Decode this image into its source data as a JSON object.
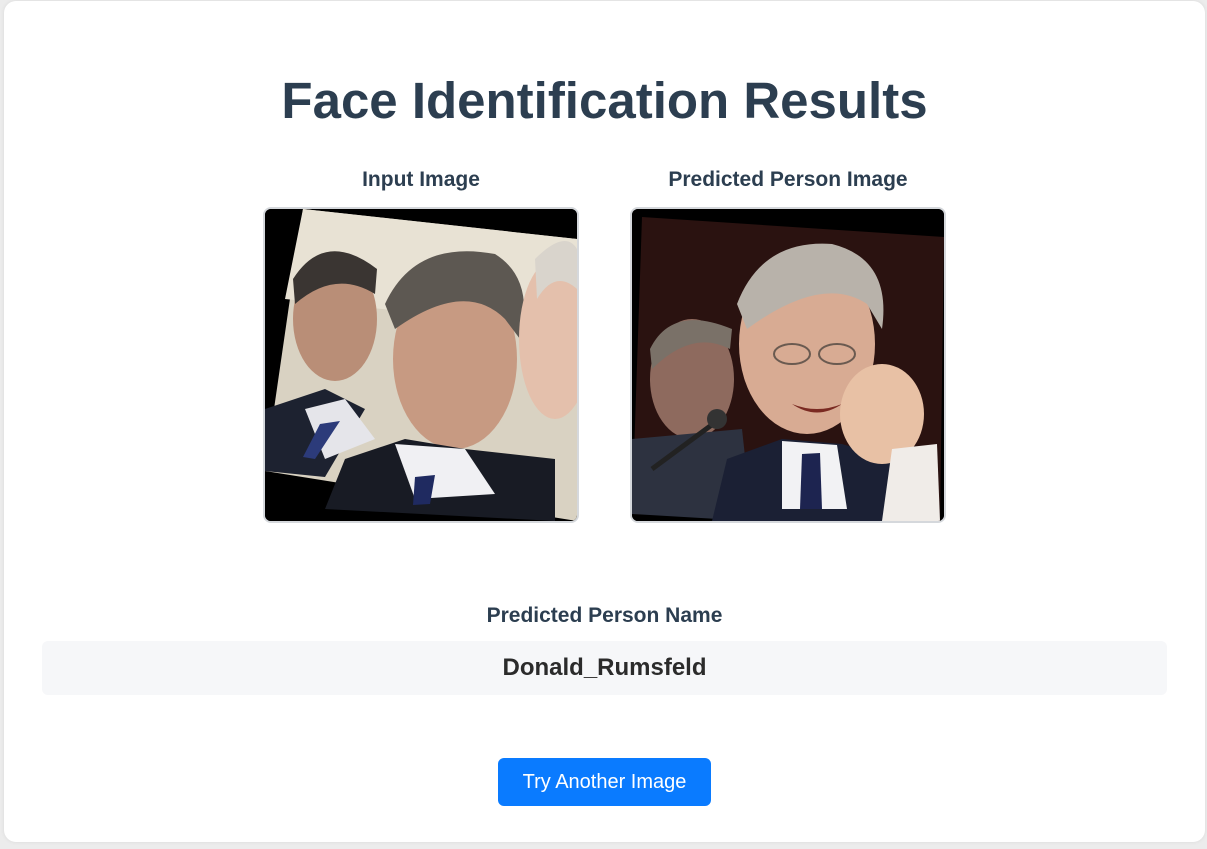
{
  "page": {
    "title": "Face Identification Results"
  },
  "images": {
    "input_label": "Input Image",
    "predicted_label": "Predicted Person Image"
  },
  "result": {
    "name_label": "Predicted Person Name",
    "name_value": "Donald_Rumsfeld"
  },
  "actions": {
    "try_again_label": "Try Another Image"
  },
  "colors": {
    "heading": "#2c3e50",
    "button": "#0a7bff",
    "name_box": "#f6f7f9"
  }
}
